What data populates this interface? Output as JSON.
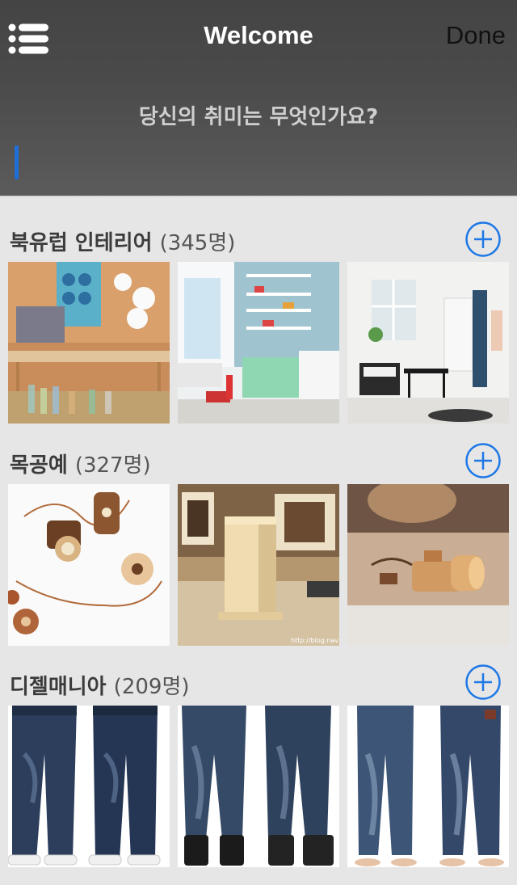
{
  "header": {
    "title": "Welcome",
    "done_label": "Done",
    "menu_icon": "hamburger-list-icon"
  },
  "prompt": {
    "question": "당신의 취미는 무엇인가요?",
    "cursor_color": "#1e6fd8"
  },
  "accent_color": "#1e78e6",
  "sections": [
    {
      "title": "북유럽 인테리어",
      "count": "(345명)",
      "add_icon": "plus-circle-icon",
      "photos": [
        "nordic-shop-interior",
        "shelves-kids-room",
        "white-living-room"
      ]
    },
    {
      "title": "목공예",
      "count": "(327명)",
      "add_icon": "plus-circle-icon",
      "photos": [
        "wooden-camera-necklaces",
        "wooden-pencil-holder",
        "wooden-toy-camera"
      ]
    },
    {
      "title": "디젤매니아",
      "count": "(209명)",
      "add_icon": "plus-circle-icon",
      "photos": [
        "jeans-white-sneakers",
        "jeans-black-boots",
        "jeans-barefoot"
      ]
    }
  ],
  "watermark": "http://blog.nav"
}
